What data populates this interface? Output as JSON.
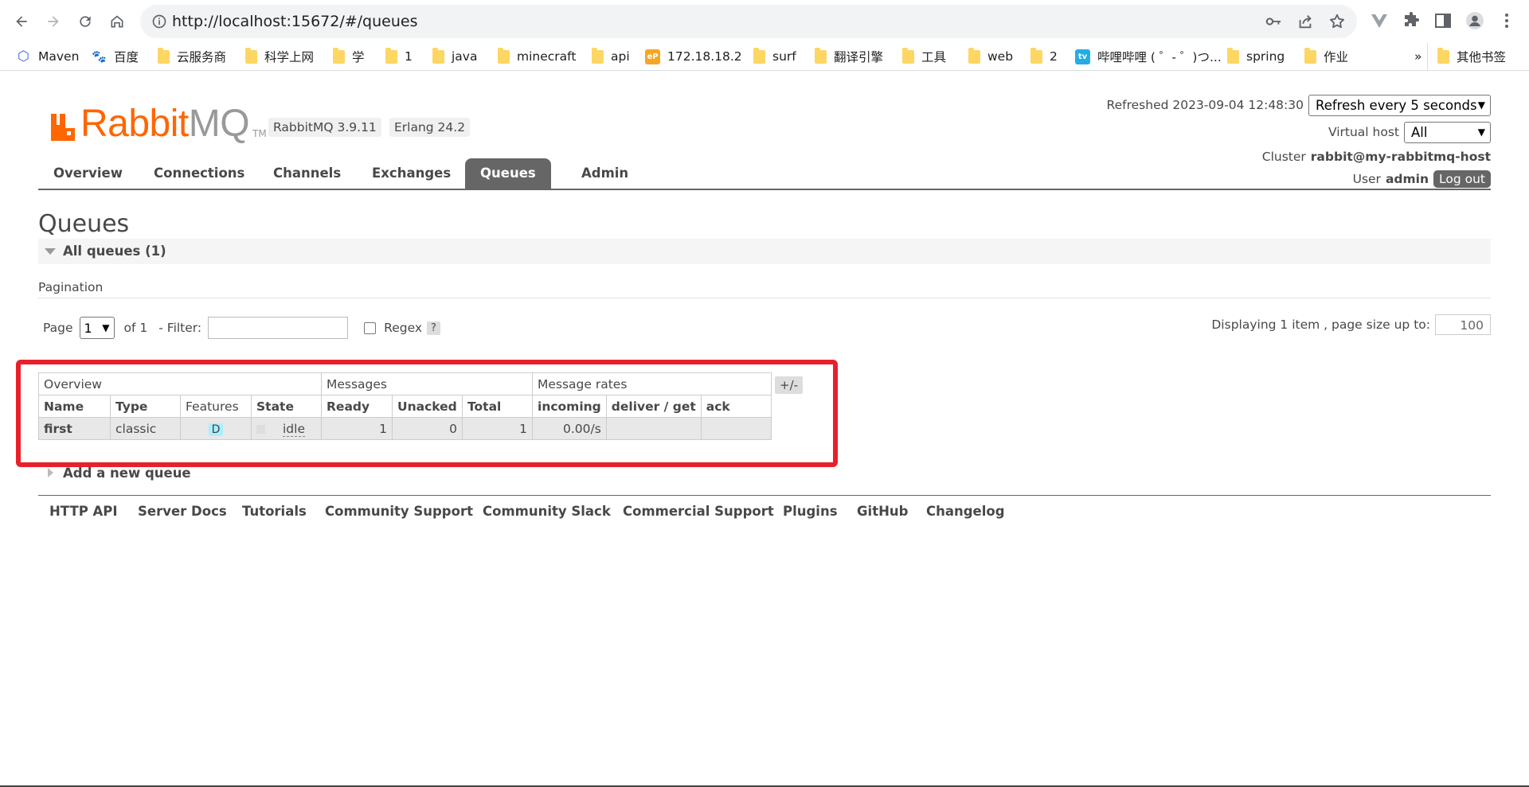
{
  "browser": {
    "url": "http://localhost:15672/#/queues",
    "bookmarks": [
      {
        "label": "Maven",
        "icon": "maven-icon"
      },
      {
        "label": "百度",
        "icon": "baidu-icon"
      },
      {
        "label": "云服务商",
        "icon": "folder-icon"
      },
      {
        "label": "科学上网",
        "icon": "folder-icon"
      },
      {
        "label": "学",
        "icon": "folder-icon"
      },
      {
        "label": "1",
        "icon": "folder-icon"
      },
      {
        "label": "java",
        "icon": "folder-icon"
      },
      {
        "label": "minecraft",
        "icon": "folder-icon"
      },
      {
        "label": "api",
        "icon": "folder-icon"
      },
      {
        "label": "172.18.18.2",
        "icon": "ep-icon"
      },
      {
        "label": "surf",
        "icon": "folder-icon"
      },
      {
        "label": "翻译引擎",
        "icon": "folder-icon"
      },
      {
        "label": "工具",
        "icon": "folder-icon"
      },
      {
        "label": "web",
        "icon": "folder-icon"
      },
      {
        "label": "2",
        "icon": "folder-icon"
      },
      {
        "label": "哔哩哔哩 ( ゜- ゜)つ...",
        "icon": "bilibili-icon"
      },
      {
        "label": "spring",
        "icon": "folder-icon"
      },
      {
        "label": "作业",
        "icon": "folder-icon"
      }
    ],
    "more_bookmarks": "»",
    "other_bookmarks": "其他书签"
  },
  "header": {
    "logo_rabbit": "Rabbit",
    "logo_mq": "MQ",
    "logo_tm": "TM",
    "rabbitmq_version": "RabbitMQ 3.9.11",
    "erlang_version": "Erlang 24.2",
    "refreshed_label": "Refreshed 2023-09-04 12:48:30",
    "refresh_select": "Refresh every 5 seconds",
    "vhost_label": "Virtual host",
    "vhost_select": "All",
    "cluster_label": "Cluster",
    "cluster_name": "rabbit@my-rabbitmq-host",
    "user_label": "User",
    "user_name": "admin",
    "logout": "Log out"
  },
  "tabs": [
    "Overview",
    "Connections",
    "Channels",
    "Exchanges",
    "Queues",
    "Admin"
  ],
  "active_tab": "Queues",
  "main": {
    "title": "Queues",
    "section_label": "All queues (1)",
    "pagination_label": "Pagination",
    "page_label": "Page",
    "page_value": "1",
    "of_label": "of 1",
    "filter_label": "- Filter:",
    "regex_label": "Regex",
    "help": "?",
    "displaying": "Displaying 1 item , page size up to:",
    "page_size": "100"
  },
  "table": {
    "groups": [
      "Overview",
      "Messages",
      "Message rates"
    ],
    "columns": [
      "Name",
      "Type",
      "Features",
      "State",
      "Ready",
      "Unacked",
      "Total",
      "incoming",
      "deliver / get",
      "ack"
    ],
    "rows": [
      {
        "name": "first",
        "type": "classic",
        "features": "D",
        "state": "idle",
        "ready": "1",
        "unacked": "0",
        "total": "1",
        "incoming": "0.00/s",
        "deliver_get": "",
        "ack": ""
      }
    ],
    "toggle": "+/-"
  },
  "add_queue": "Add a new queue",
  "footer": [
    "HTTP API",
    "Server Docs",
    "Tutorials",
    "Community Support",
    "Community Slack",
    "Commercial Support",
    "Plugins",
    "GitHub",
    "Changelog"
  ],
  "colors": {
    "brand_orange": "#ff6600",
    "tab_active": "#666666",
    "highlight_frame": "#e8202a",
    "features_badge": "#aaeeff"
  }
}
